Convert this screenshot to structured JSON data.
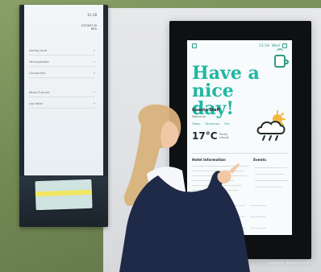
{
  "tablet": {
    "time": "13:28",
    "header": [
      "ESTIMIT IR",
      "REA"
    ],
    "rows": [
      "eading kend",
      "Versuagesitoc",
      "Urnsatchon",
      "ditore Futuree",
      "use Rdde"
    ]
  },
  "display": {
    "status_time": "13:18",
    "status_right": "Wed",
    "greeting": "Have a nice day!",
    "guest_name": "Guests Staff",
    "guest_sub": "Welcome",
    "weather_tabs": [
      "Today",
      "Tomorrow",
      "Thu"
    ],
    "temperature": "17°C",
    "temp_detail": [
      "Partly",
      "cloudy"
    ],
    "section_left_title": "Hotel Information",
    "section_right_title": "Events",
    "accent": "#21b6a3"
  },
  "caption": "sample watermark"
}
